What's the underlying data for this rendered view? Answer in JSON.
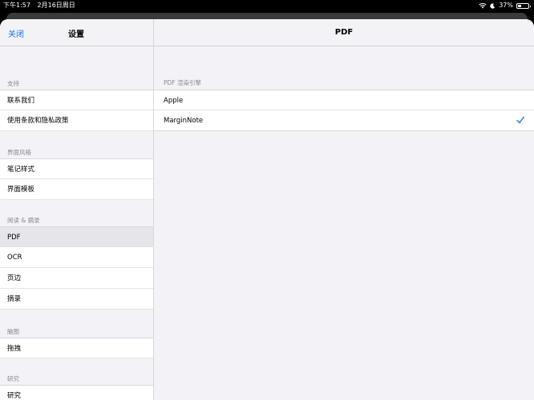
{
  "status_bar": {
    "time": "下午1:57",
    "date": "2月16日周日",
    "battery": "37%",
    "battery_level": 0.37
  },
  "left": {
    "close_label": "关闭",
    "title": "设置",
    "sections": [
      {
        "header": "支持",
        "items": [
          "联系我们",
          "使用条款和隐私政策"
        ]
      },
      {
        "header": "界面风格",
        "items": [
          "笔记样式",
          "界面模板"
        ]
      },
      {
        "header": "阅读 & 摘录",
        "items": [
          "PDF",
          "OCR",
          "页边",
          "摘录"
        ]
      },
      {
        "header": "脑图",
        "items": [
          "拖拽"
        ]
      },
      {
        "header": "研究",
        "items": [
          "研究"
        ]
      }
    ],
    "selected_item": "PDF"
  },
  "right": {
    "title": "PDF",
    "section_header": "PDF 渲染引擎",
    "options": [
      "Apple",
      "MarginNote"
    ],
    "selected_option": "MarginNote"
  },
  "colors": {
    "accent": "#1a73e8",
    "background": "#f2f2f7",
    "selected_row": "#e5e5ea"
  }
}
